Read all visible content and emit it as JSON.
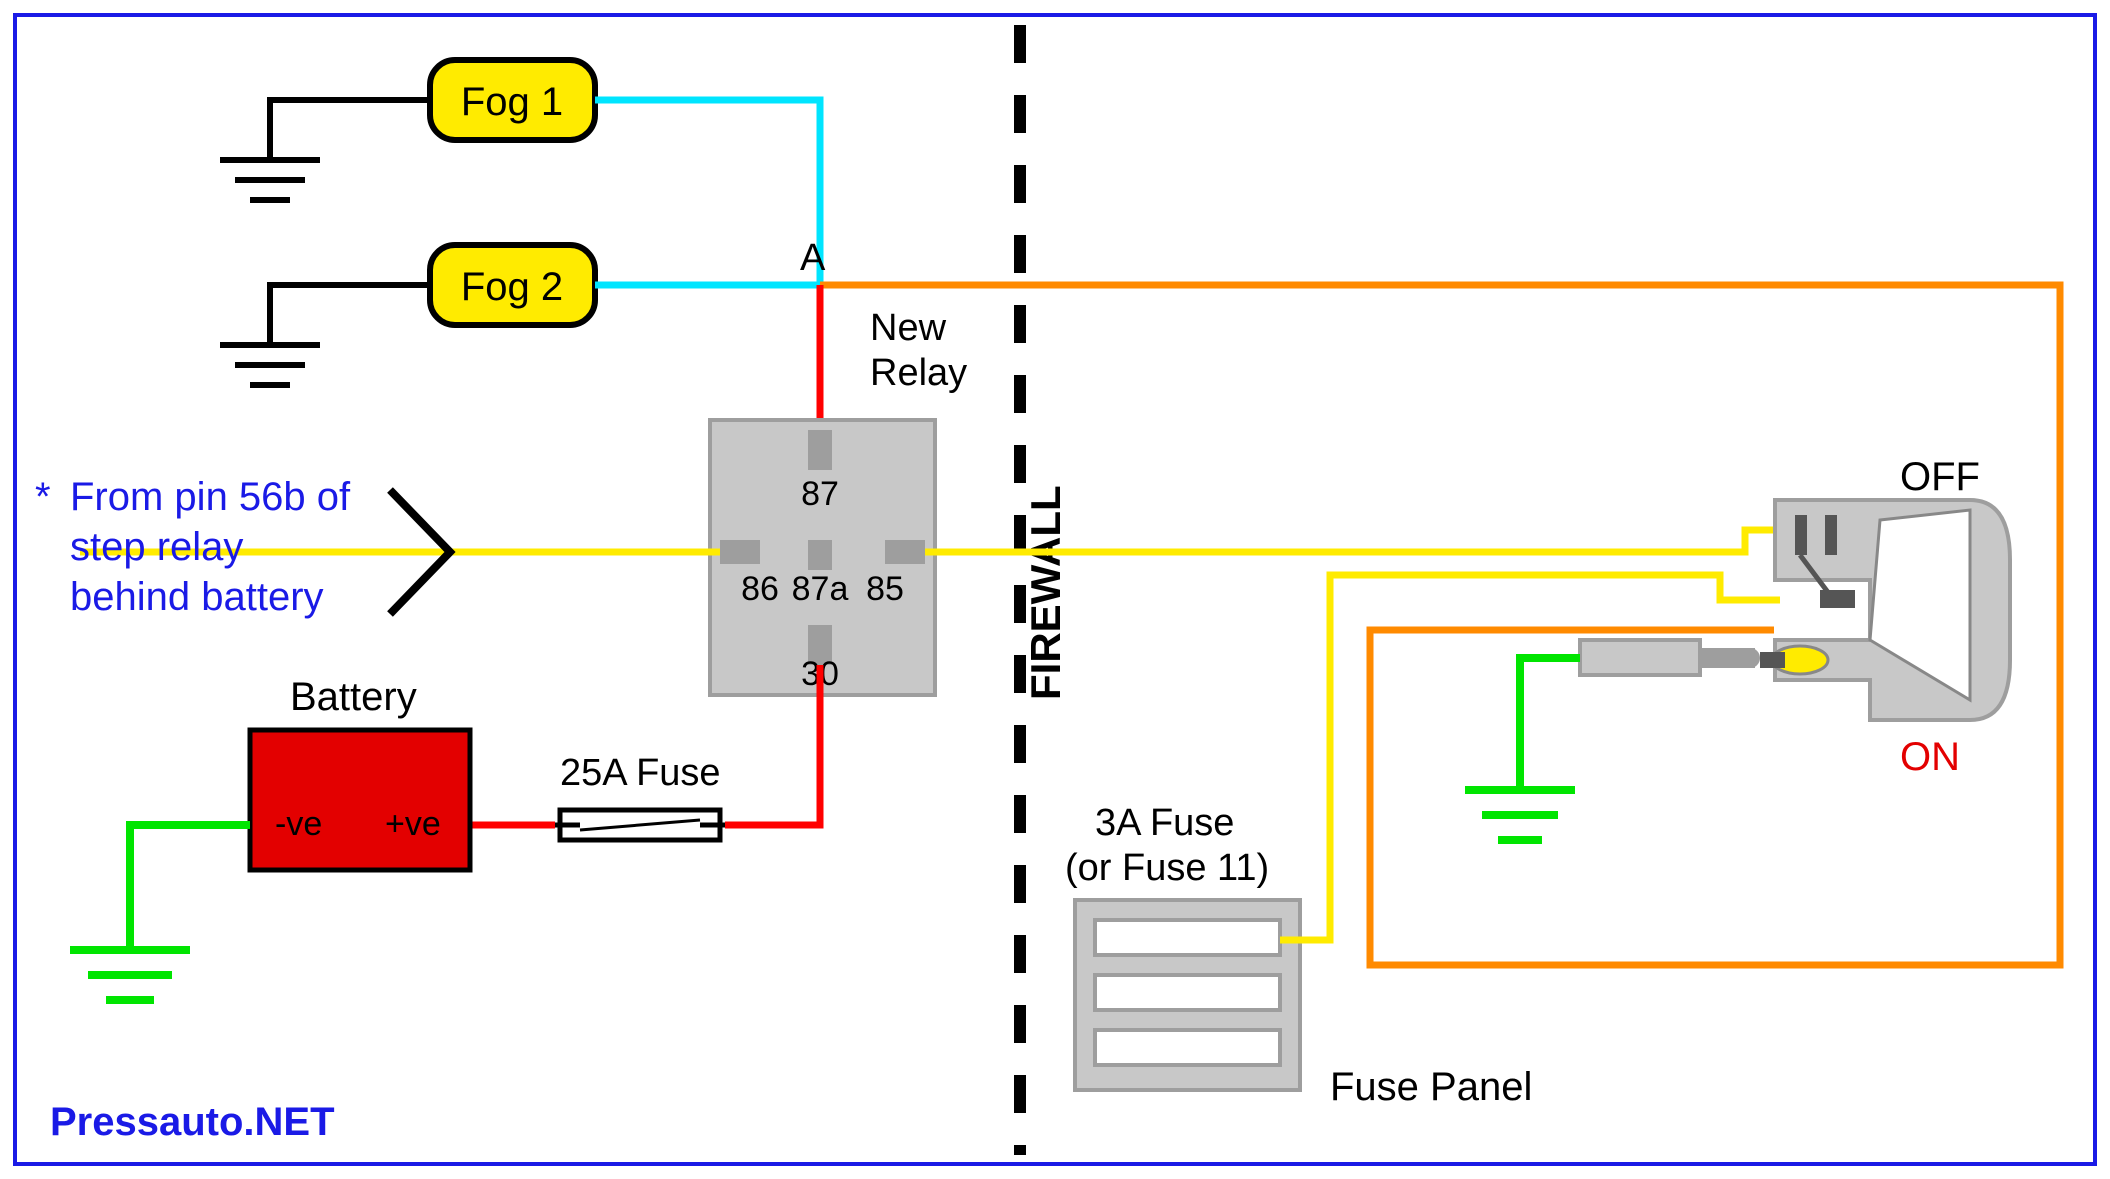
{
  "labels": {
    "fog1": "Fog 1",
    "fog2": "Fog 2",
    "nodeA": "A",
    "newRelay": "New Relay",
    "relay": {
      "p87": "87",
      "p87a": "87a",
      "p86": "86",
      "p85": "85",
      "p30": "30"
    },
    "firewall": "FIREWALL",
    "battery": "Battery",
    "batNeg": "-ve",
    "batPos": "+ve",
    "fuse25": "25A Fuse",
    "fuse3": "3A Fuse",
    "fuse3sub": "(or Fuse 11)",
    "fusePanel": "Fuse Panel",
    "off": "OFF",
    "on": "ON",
    "noteStar": "*",
    "note1": "From pin 56b of",
    "note2": "step relay",
    "note3": "behind battery",
    "attribution": "Pressauto.NET"
  },
  "colors": {
    "cyan": "#00E5FF",
    "yellow": "#FFEB00",
    "red": "#FF0000",
    "darkRed": "#E30000",
    "orange": "#FF8A00",
    "green": "#00E500",
    "blue": "#1A1AE6",
    "grey": "#C8C8C8",
    "midGrey": "#9E9E9E",
    "border": "#1A1AE6"
  }
}
